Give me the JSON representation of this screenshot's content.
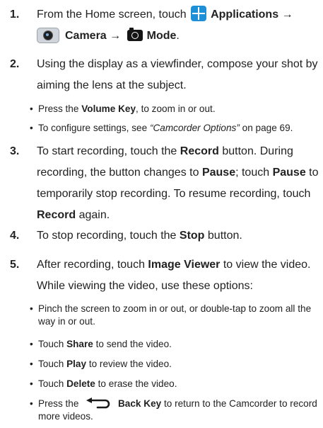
{
  "steps": [
    {
      "number": "1.",
      "t1": "From the Home screen, touch",
      "b1": "Applications",
      "arrow1": "→",
      "b2": "Camera",
      "arrow2": "→",
      "b3": "Mode",
      "end": "."
    },
    {
      "number": "2.",
      "text": "Using the display as a viewfinder, compose your shot by aiming the lens at the subject."
    },
    {
      "number": "3.",
      "t1": "To start recording, touch the",
      "b1": "Record",
      "t2": "button. During recording, the button changes to",
      "b2": "Pause",
      "t3": "; touch",
      "b3": "Pause",
      "t4": "to temporarily stop recording. To resume recording, touch",
      "b4": "Record",
      "t5": "again."
    },
    {
      "number": "4.",
      "t1": "To stop recording, touch the",
      "b1": "Stop",
      "t2": "button."
    },
    {
      "number": "5.",
      "t1": "After recording, touch",
      "b1": "Image Viewer",
      "t2": "to view the video. While viewing the video, use these options:"
    }
  ],
  "step2_bullets": [
    {
      "t1": "Press the",
      "b1": "Volume Key",
      "t2": ", to zoom in or out."
    },
    {
      "t1": "To configure settings, see",
      "link": "“Camcorder Options”",
      "t2": "on page 69."
    }
  ],
  "step5_bullets": [
    {
      "text": "Pinch the screen to zoom in or out, or double-tap to zoom all the way in or out."
    },
    {
      "t1": "Touch",
      "b1": "Share",
      "t2": "to send the video."
    },
    {
      "t1": "Touch",
      "b1": "Play",
      "t2": "to review the video."
    },
    {
      "t1": "Touch",
      "b1": "Delete",
      "t2": " to erase the video."
    },
    {
      "t1": "Press the",
      "b1": "Back Key",
      "t2": "to return to the Camcorder to record more videos."
    }
  ],
  "icons": {
    "applications": "applications-icon",
    "camera": "camera-icon",
    "mode": "camcorder-mode-icon",
    "back": "back-key-icon"
  },
  "colors": {
    "applications_icon": "#1e90d8",
    "text": "#222222"
  }
}
